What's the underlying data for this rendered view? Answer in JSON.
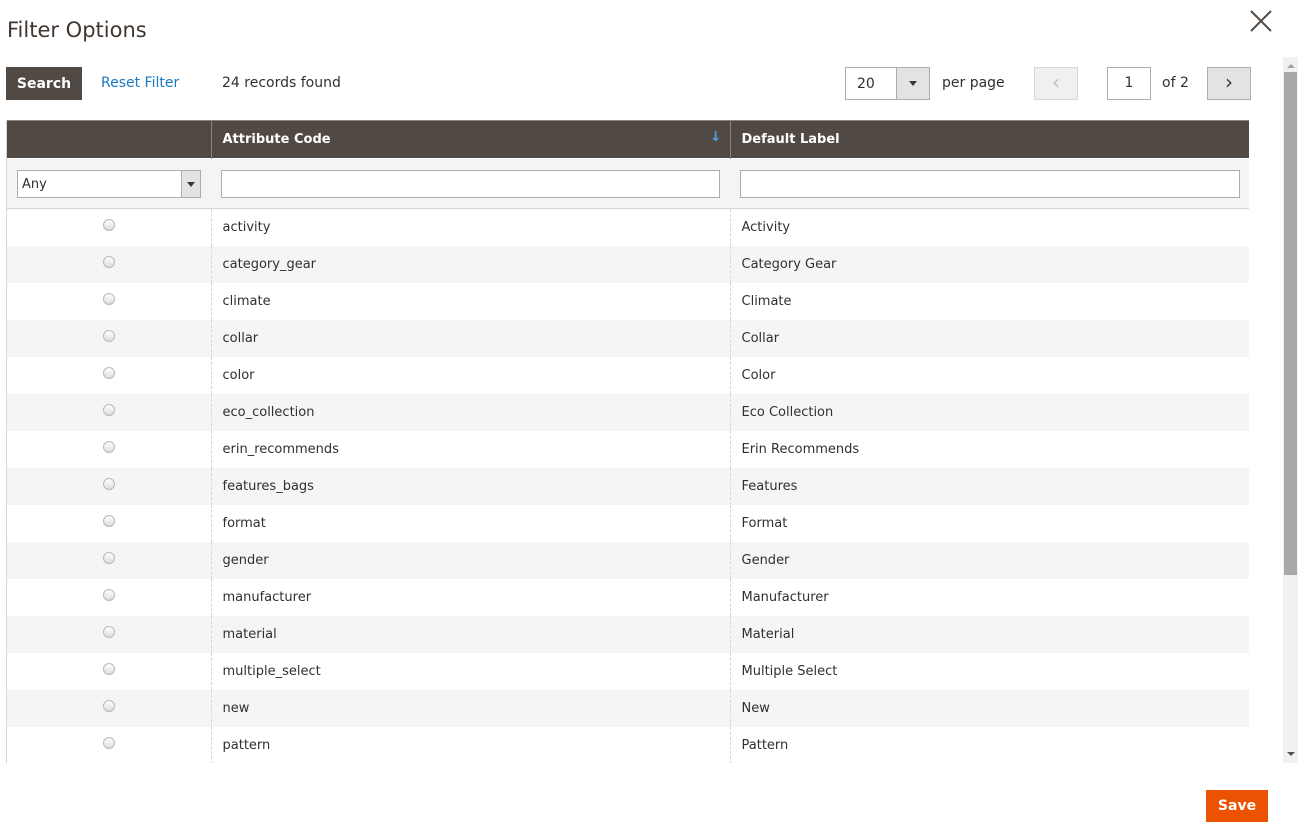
{
  "title": "Filter Options",
  "toolbar": {
    "search_label": "Search",
    "reset_label": "Reset Filter",
    "records": "24 records found",
    "per_page_value": "20",
    "per_page_label": "per page",
    "prev": "‹",
    "page": "1",
    "of": "of 2",
    "next": "›"
  },
  "columns": [
    "",
    "Attribute Code",
    "Default Label"
  ],
  "sort_icon": "↓",
  "filters": {
    "select_value": "Any"
  },
  "rows": [
    [
      "activity",
      "Activity"
    ],
    [
      "category_gear",
      "Category Gear"
    ],
    [
      "climate",
      "Climate"
    ],
    [
      "collar",
      "Collar"
    ],
    [
      "color",
      "Color"
    ],
    [
      "eco_collection",
      "Eco Collection"
    ],
    [
      "erin_recommends",
      "Erin Recommends"
    ],
    [
      "features_bags",
      "Features"
    ],
    [
      "format",
      "Format"
    ],
    [
      "gender",
      "Gender"
    ],
    [
      "manufacturer",
      "Manufacturer"
    ],
    [
      "material",
      "Material"
    ],
    [
      "multiple_select",
      "Multiple Select"
    ],
    [
      "new",
      "New"
    ],
    [
      "pattern",
      "Pattern"
    ]
  ],
  "save_label": "Save",
  "colors": {
    "header": "#514943",
    "accent": "#eb5202",
    "link": "#1979c3"
  }
}
